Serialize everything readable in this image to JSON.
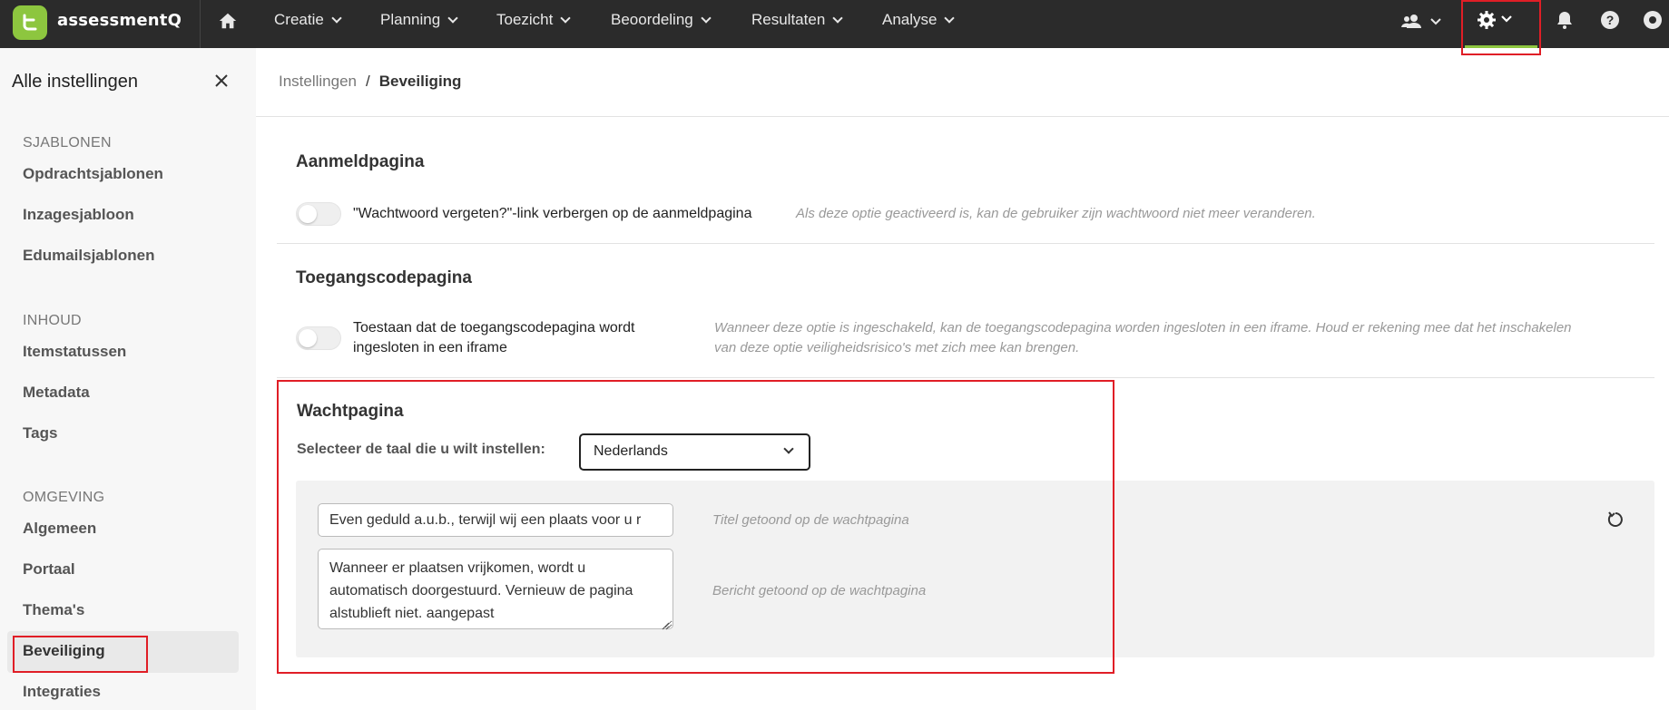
{
  "header": {
    "brand": "assessmentQ",
    "nav": [
      {
        "label": "Creatie"
      },
      {
        "label": "Planning"
      },
      {
        "label": "Toezicht"
      },
      {
        "label": "Beoordeling"
      },
      {
        "label": "Resultaten"
      },
      {
        "label": "Analyse"
      }
    ],
    "icons": [
      "home-icon",
      "users-icon",
      "gear-icon",
      "bell-icon",
      "help-icon"
    ]
  },
  "sidebar": {
    "title": "Alle instellingen",
    "groups": [
      {
        "label": "SJABLONEN",
        "items": [
          {
            "label": "Opdrachtsjablonen"
          },
          {
            "label": "Inzagesjabloon"
          },
          {
            "label": "Edumailsjablonen"
          }
        ]
      },
      {
        "label": "INHOUD",
        "items": [
          {
            "label": "Itemstatussen"
          },
          {
            "label": "Metadata"
          },
          {
            "label": "Tags"
          }
        ]
      },
      {
        "label": "OMGEVING",
        "items": [
          {
            "label": "Algemeen"
          },
          {
            "label": "Portaal"
          },
          {
            "label": "Thema's"
          },
          {
            "label": "Beveiliging"
          },
          {
            "label": "Integraties"
          }
        ]
      }
    ],
    "active_item": "Beveiliging"
  },
  "breadcrumb": {
    "parent": "Instellingen",
    "separator": "/",
    "current": "Beveiliging"
  },
  "sections": {
    "login": {
      "title": "Aanmeldpagina",
      "option_label": "\"Wachtwoord vergeten?\"-link verbergen op de aanmeldpagina",
      "option_hint": "Als deze optie geactiveerd is, kan de gebruiker zijn wachtwoord niet meer veranderen.",
      "enabled": false
    },
    "access_code": {
      "title": "Toegangscodepagina",
      "option_label_line1": "Toestaan dat de toegangscodepagina wordt",
      "option_label_line2": "ingesloten in een iframe",
      "option_hint_line1": "Wanneer deze optie is ingeschakeld, kan de toegangscodepagina worden ingesloten in een iframe. Houd er rekening mee dat het inschakelen",
      "option_hint_line2": "van deze optie veiligheidsrisico's met zich mee kan brengen.",
      "enabled": false
    },
    "waiting": {
      "title": "Wachtpagina",
      "language_label": "Selecteer de taal die u wilt instellen:",
      "language_value": "Nederlands",
      "title_field_value": "Even geduld a.u.b., terwijl wij een plaats voor u r",
      "title_field_hint": "Titel getoond op de wachtpagina",
      "message_line1": "Wanneer er plaatsen vrijkomen, wordt u",
      "message_line2": "automatisch doorgestuurd. Vernieuw de pagina",
      "message_line3": "alstublieft niet. aangepast",
      "message_hint": "Bericht getoond op de wachtpagina"
    }
  },
  "colors": {
    "topbar": "#2b2b2b",
    "accent": "#8dc63f",
    "highlight": "#e01e26"
  }
}
